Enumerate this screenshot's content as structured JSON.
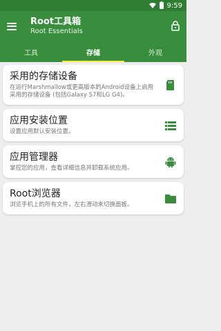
{
  "status": {
    "time": "9:59"
  },
  "appbar": {
    "title": "Root工具箱",
    "subtitle": "Root Essentials"
  },
  "tabs": [
    {
      "label": "工具",
      "active": false
    },
    {
      "label": "存储",
      "active": true
    },
    {
      "label": "外观",
      "active": false
    }
  ],
  "cards": [
    {
      "title": "采用的存储设备",
      "desc": "在运行Marshmallow或更高版本的Android设备上启用采用的存储设备 (包括Galaxy S7和LG G4)。",
      "icon": "sd-card-icon"
    },
    {
      "title": "应用安装位置",
      "desc": "设置应用默认安装位置。",
      "icon": "list-icon"
    },
    {
      "title": "应用管理器",
      "desc": "掌控您的应用，查看详细信息并卸载系统应用。",
      "icon": "android-icon"
    },
    {
      "title": "Root浏览器",
      "desc": "浏览手机上的所有文件，左右滑动来切换面板。",
      "icon": "folder-icon"
    }
  ],
  "colors": {
    "primary": "#388e3c",
    "statusbar": "#2e7d32",
    "tab_indicator": "#ffeb3b"
  }
}
